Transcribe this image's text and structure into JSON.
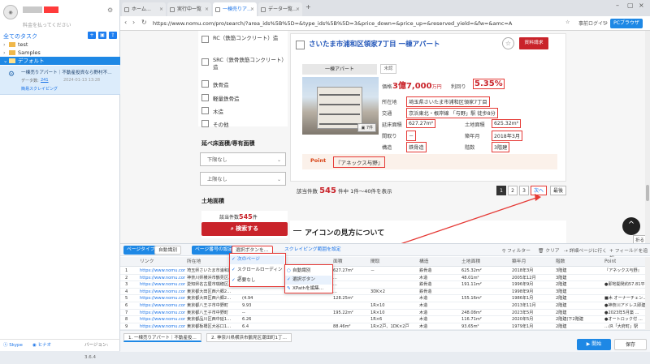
{
  "app": {
    "settings_icon": "gear-icon",
    "user_sub": "料金を払ってください",
    "tasks_title": "全てのタスク",
    "folders": [
      {
        "name": "test"
      },
      {
        "name": "Samples"
      },
      {
        "name": "デフォルト"
      }
    ],
    "task": {
      "title": "一棟売りアパート｜不動産投資なら野村不…",
      "data_label": "データ数:",
      "data_count": "241",
      "date": "2024-01-13 13:28",
      "action": "簡易スクレイピング"
    },
    "footer": {
      "skype": "Skype",
      "guide": "ヒナオ",
      "version": "バージョン: 3.6.4"
    }
  },
  "browser": {
    "tabs": [
      {
        "label": "ホーム…"
      },
      {
        "label": "実行中一覧"
      },
      {
        "label": "一棟売りア…"
      },
      {
        "label": "データ一覧…"
      }
    ],
    "new_tab": "+",
    "url": "https://www.nomu.com/pro/search/?area_ids%5B%5D=&type_ids%5B%5D=3&price_down=&price_up=&reserved_yield=&fw=&amc=A",
    "actions": {
      "prelogin": "事前ログイン",
      "pc_browser": "PCブラウザ"
    }
  },
  "page": {
    "structures": [
      "RC（鉄筋コンクリート）造",
      "SRC（鉄骨鉄筋コンクリート）造",
      "鉄骨造",
      "軽量鉄骨造",
      "木造",
      "その他"
    ],
    "floor_area": {
      "heading": "延べ床面積/専有面積",
      "min": "下限なし",
      "max": "上限なし"
    },
    "land_area": {
      "heading": "土地面積",
      "count_label": "該当件数",
      "count": "545",
      "count_unit": "件",
      "search": "検索する"
    },
    "listing": {
      "title": "さいたま市浦和区領家7丁目 一棟アパート",
      "request": "資料請求",
      "type": "一棟アパート",
      "tag": "未認",
      "image_count": "7件",
      "price_label": "価格",
      "price": "3億7,000",
      "price_unit": "万円",
      "yield_label": "利回り",
      "yield": "5.35%",
      "location_label": "所在地",
      "location": "埼玉県さいたま市浦和区領家7丁目",
      "traffic_label": "交通",
      "traffic": "京浜東北・根岸線 「与野」駅 徒歩8分",
      "floor_label": "延床面積",
      "floor": "627.27m²",
      "land_label": "土地面積",
      "land": "625.32m²",
      "layout_label": "間取り",
      "layout": "－",
      "built_label": "築年月",
      "built": "2018年3月",
      "struct_label": "構造",
      "struct": "鉄骨造",
      "floors_label": "階数",
      "floors": "3階建",
      "point_label": "Point",
      "point": "『アネックス与野』"
    },
    "results": {
      "prefix": "該当件数",
      "count": "545",
      "suffix": "件中 1件～40件を表示"
    },
    "pagination": [
      "1",
      "2",
      "3",
      "次へ",
      "最後"
    ],
    "icon_section": "アイコンの見方について",
    "back_to_top": "^",
    "fold": "折る"
  },
  "panel": {
    "toolbar": {
      "page_type": "ページタイプ",
      "auto_detect": "自動識別",
      "pagination_setting": "ページ番号の設定",
      "select_button": "選択ボタンを…",
      "scroll_range": "スクレイピング範囲を設定",
      "filter": "フィルター",
      "clear": "クリア",
      "detail": "詳細ページに行く",
      "add_field": "フィールドを追加"
    },
    "columns": [
      "リンク",
      "所在地",
      "",
      "面積",
      "間取",
      "構造",
      "土地面積",
      "築年月",
      "階数",
      "Point"
    ],
    "rows": [
      [
        "https://www.nomu.com/...",
        "埼玉県さいたま市浦和区…",
        "",
        "627.27m²",
        "－",
        "鉄骨造",
        "625.32m²",
        "2018年3月",
        "3階建",
        "『アネックス与野』"
      ],
      [
        "https://www.nomu.com/...",
        "神奈川県横浜市鶴見区…",
        "",
        "...",
        "",
        "木造",
        "48.01m²",
        "2005年12月",
        "3階建",
        ""
      ],
      [
        "https://www.nomu.com/...",
        "愛知県名古屋市瑞穂区…",
        "",
        "...",
        "",
        "鉄骨造",
        "191.11m²",
        "1996年9月",
        "2階建",
        "●即地開発約57.81平"
      ],
      [
        "https://www.nomu.com/...",
        "東京都大田区西六郷2…",
        "",
        "...",
        "3DK×2",
        "鉄骨造",
        "",
        "1998年9月",
        "3階建",
        ""
      ],
      [
        "https://www.nomu.com/...",
        "東京都大田区西六郷2…",
        "(4.94",
        "128.25m²",
        "",
        "木造",
        "155.16m²",
        "1986年1月",
        "2階建",
        "■木 オーナーチェン…"
      ],
      [
        "https://www.nomu.com/...",
        "東京都八王子市中野町",
        "9.93",
        "",
        "1R×10",
        "木造",
        "",
        "2013年11月",
        "2階建",
        "●神奈川アドレス即建物"
      ],
      [
        "https://www.nomu.com/...",
        "東京都八王子市中野町",
        "--",
        "195.22m²",
        "1R×10",
        "木造",
        "248.08m²",
        "2023年5月",
        "2階建",
        "●2023年5月築 …"
      ],
      [
        "https://www.nomu.com/...",
        "東京都品川区西中延1…",
        "6.26",
        "",
        "1R×6",
        "木造",
        "116.71m²",
        "2020年5月",
        "2階建(下2階建",
        "●オートロック付 …"
      ],
      [
        "https://www.nomu.com/...",
        "東京都板橋区大谷口1…",
        "6.4",
        "88.46m²",
        "1R×2戸、1DK×2戸",
        "木造",
        "93.65m²",
        "1979年1月",
        "2階建",
        "…(R「大府町」駅"
      ]
    ],
    "dropdown1": [
      "次のページ",
      "スクロールローディング",
      "必要なし"
    ],
    "dropdown2": [
      "自動識別",
      "選択ボタン",
      "XPathを編集…"
    ],
    "bottom_tabs": [
      "1. 一棟売りアパート｜不動産投…",
      "2. 神奈川県横浜市鶴見区潮田町1丁…"
    ],
    "start": "開始",
    "save": "保存"
  }
}
